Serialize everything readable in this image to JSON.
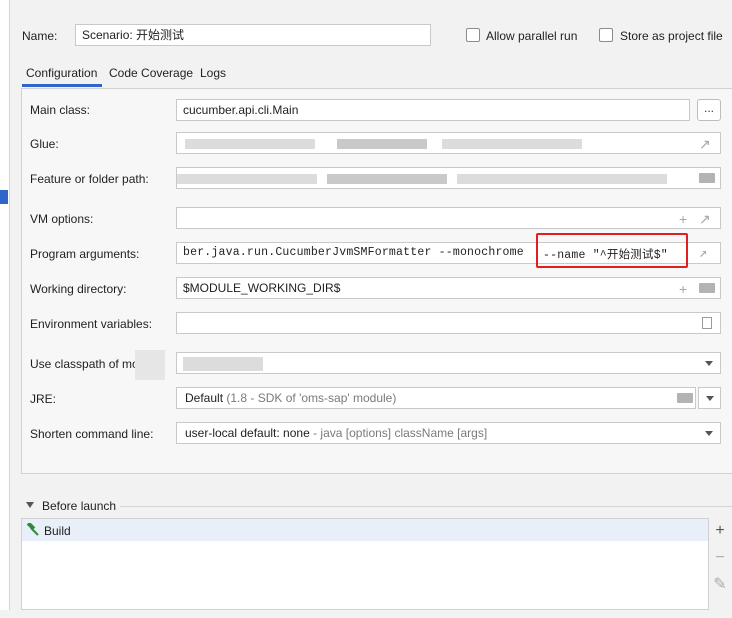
{
  "header": {
    "name_label": "Name:",
    "name_value": "Scenario: 开始测试",
    "allow_parallel": "Allow parallel run",
    "store_project": "Store as project file"
  },
  "tabs": [
    "Configuration",
    "Code Coverage",
    "Logs"
  ],
  "fields": {
    "main_class": {
      "label": "Main class:",
      "value": "cucumber.api.cli.Main",
      "button": "..."
    },
    "glue": {
      "label": "Glue:"
    },
    "feature": {
      "label": "Feature or folder path:"
    },
    "vm": {
      "label": "VM options:"
    },
    "program": {
      "label": "Program arguments:",
      "value": "ber.java.run.CucumberJvmSMFormatter --monochrome",
      "highlight": "--name \"^开始测试$\""
    },
    "workdir": {
      "label": "Working directory:",
      "value": "$MODULE_WORKING_DIR$"
    },
    "env": {
      "label": "Environment variables:"
    },
    "classpath": {
      "label": "Use classpath of mo"
    },
    "jre": {
      "label": "JRE:",
      "value": "Default",
      "detail": "(1.8 - SDK of 'oms-sap' module)"
    },
    "shorten": {
      "label": "Shorten command line:",
      "value": "user-local default: none",
      "detail": "- java [options] className [args]"
    }
  },
  "before_launch": {
    "title": "Before launch",
    "items": [
      {
        "label": "Build",
        "icon": "hammer-icon"
      }
    ]
  },
  "icons": {
    "expand": "↗",
    "plus": "+",
    "folder": "folder-icon",
    "env_doc": "document-icon",
    "side_minus": "−",
    "side_edit": "✎",
    "side_plus": "+"
  },
  "colors": {
    "accent": "#2f65ca",
    "highlight_border": "#e02020"
  }
}
